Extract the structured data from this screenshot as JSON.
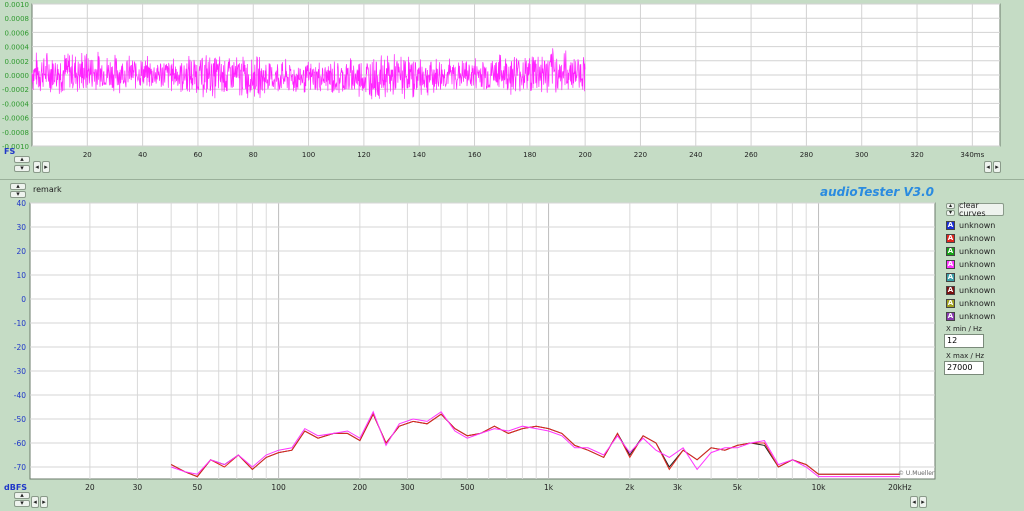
{
  "top_graph": {
    "y_unit": "FS",
    "y_ticks": [
      "0.0010",
      "0.0008",
      "0.0006",
      "0.0004",
      "0.0002",
      "0.0000",
      "-0.0002",
      "-0.0004",
      "-0.0006",
      "-0.0008",
      "-0.0010"
    ],
    "x_ticks": [
      "20",
      "40",
      "60",
      "80",
      "100",
      "120",
      "140",
      "160",
      "180",
      "200",
      "220",
      "240",
      "260",
      "280",
      "300",
      "320",
      "340ms"
    ],
    "signal_color": "#ff22ff",
    "signal_end_ms": 200,
    "x_range_ms": [
      0,
      350
    ],
    "y_range": [
      -0.001,
      0.001
    ]
  },
  "header": {
    "remark_label": "remark",
    "app_title": "audioTester  V3.0"
  },
  "bottom_graph": {
    "y_unit": "dBFS",
    "y_ticks": [
      "40",
      "30",
      "20",
      "10",
      "0",
      "-10",
      "-20",
      "-30",
      "-40",
      "-50",
      "-60",
      "-70"
    ],
    "x_ticks": [
      "20",
      "30",
      "50",
      "100",
      "200",
      "300",
      "500",
      "1k",
      "2k",
      "3k",
      "5k",
      "10k",
      "20kHz"
    ],
    "watermark": "© U.Mueller"
  },
  "controls": {
    "clear_curves": "clear curves",
    "curves": [
      {
        "letter": "A",
        "label": "unknown",
        "color": "#1a2fd6"
      },
      {
        "letter": "A",
        "label": "unknown",
        "color": "#e0261e"
      },
      {
        "letter": "A",
        "label": "unknown",
        "color": "#16a016"
      },
      {
        "letter": "A",
        "label": "unknown",
        "color": "#ff33ff"
      },
      {
        "letter": "A",
        "label": "unknown",
        "color": "#3aa0a8"
      },
      {
        "letter": "A",
        "label": "unknown",
        "color": "#7a1010"
      },
      {
        "letter": "A",
        "label": "unknown",
        "color": "#a0a020"
      },
      {
        "letter": "A",
        "label": "unknown",
        "color": "#8a3ab0"
      }
    ],
    "xmin_label": "X min / Hz",
    "xmin_value": "12",
    "xmax_label": "X max / Hz",
    "xmax_value": "27000"
  },
  "chart_data": {
    "type": "line",
    "xscale": "log",
    "xlim": [
      12,
      27000
    ],
    "ylim": [
      -75,
      40
    ],
    "ylabel": "dBFS",
    "series": [
      {
        "color": "#222222",
        "x": [
          40,
          45,
          50,
          56,
          63,
          71,
          80,
          90,
          100,
          112,
          125,
          140,
          160,
          180,
          200,
          224,
          250,
          280,
          315,
          355,
          400,
          450,
          500,
          560,
          630,
          710,
          800,
          900,
          1000,
          1120,
          1250,
          1400,
          1600,
          1800,
          2000,
          2240,
          2500,
          2800,
          3150,
          3550,
          4000,
          4500,
          5000,
          5600,
          6300,
          7100,
          8000,
          9000,
          10000,
          11200,
          12500,
          14000,
          16000,
          18000,
          20000
        ],
        "y": [
          -69,
          -72,
          -74,
          -67,
          -69,
          -65,
          -71,
          -66,
          -64,
          -63,
          -55,
          -58,
          -56,
          -56,
          -59,
          -48,
          -60,
          -53,
          -51,
          -52,
          -48,
          -54,
          -57,
          -56,
          -53,
          -56,
          -54,
          -53,
          -54,
          -56,
          -61,
          -63,
          -66,
          -56,
          -65,
          -57,
          -60,
          -70,
          -63,
          -67,
          -62,
          -63,
          -61,
          -60,
          -61,
          -70,
          -67,
          -69,
          -73,
          -73,
          -73,
          -73,
          -73,
          -73,
          -73
        ]
      },
      {
        "color": "#e0261e",
        "x": [
          40,
          45,
          50,
          56,
          63,
          71,
          80,
          90,
          100,
          112,
          125,
          140,
          160,
          180,
          200,
          224,
          250,
          280,
          315,
          355,
          400,
          450,
          500,
          560,
          630,
          710,
          800,
          900,
          1000,
          1120,
          1250,
          1400,
          1600,
          1800,
          2000,
          2240,
          2500,
          2800,
          3150,
          3550,
          4000,
          4500,
          5000,
          5600,
          6300,
          7100,
          8000,
          9000,
          10000,
          11200,
          12500,
          14000,
          16000,
          18000,
          20000
        ],
        "y": [
          -69,
          -72,
          -74,
          -67,
          -70,
          -65,
          -71,
          -66,
          -64,
          -63,
          -55,
          -58,
          -56,
          -56,
          -59,
          -48,
          -60,
          -53,
          -51,
          -52,
          -48,
          -54,
          -57,
          -56,
          -53,
          -56,
          -54,
          -53,
          -54,
          -56,
          -61,
          -63,
          -66,
          -56,
          -66,
          -57,
          -60,
          -71,
          -63,
          -67,
          -62,
          -63,
          -61,
          -60,
          -60,
          -70,
          -67,
          -69,
          -73,
          -73,
          -73,
          -73,
          -73,
          -73,
          -73
        ]
      },
      {
        "color": "#ff33ff",
        "x": [
          40,
          45,
          50,
          56,
          63,
          71,
          80,
          90,
          100,
          112,
          125,
          140,
          160,
          180,
          200,
          224,
          250,
          280,
          315,
          355,
          400,
          450,
          500,
          560,
          630,
          710,
          800,
          900,
          1000,
          1120,
          1250,
          1400,
          1600,
          1800,
          2000,
          2240,
          2500,
          2800,
          3150,
          3550,
          4000,
          4500,
          5000,
          5600,
          6300,
          7100,
          8000,
          9000,
          10000,
          11200,
          12500,
          14000,
          16000,
          18000,
          20000
        ],
        "y": [
          -70,
          -72,
          -73,
          -67,
          -69,
          -65,
          -70,
          -65,
          -63,
          -62,
          -54,
          -57,
          -56,
          -55,
          -58,
          -47,
          -61,
          -52,
          -50,
          -51,
          -47,
          -55,
          -58,
          -56,
          -54,
          -55,
          -53,
          -54,
          -55,
          -57,
          -62,
          -62,
          -65,
          -57,
          -64,
          -58,
          -63,
          -66,
          -62,
          -71,
          -64,
          -62,
          -62,
          -60,
          -59,
          -69,
          -67,
          -70,
          -74,
          -74,
          -74,
          -74,
          -74,
          -74,
          -74
        ]
      }
    ]
  }
}
